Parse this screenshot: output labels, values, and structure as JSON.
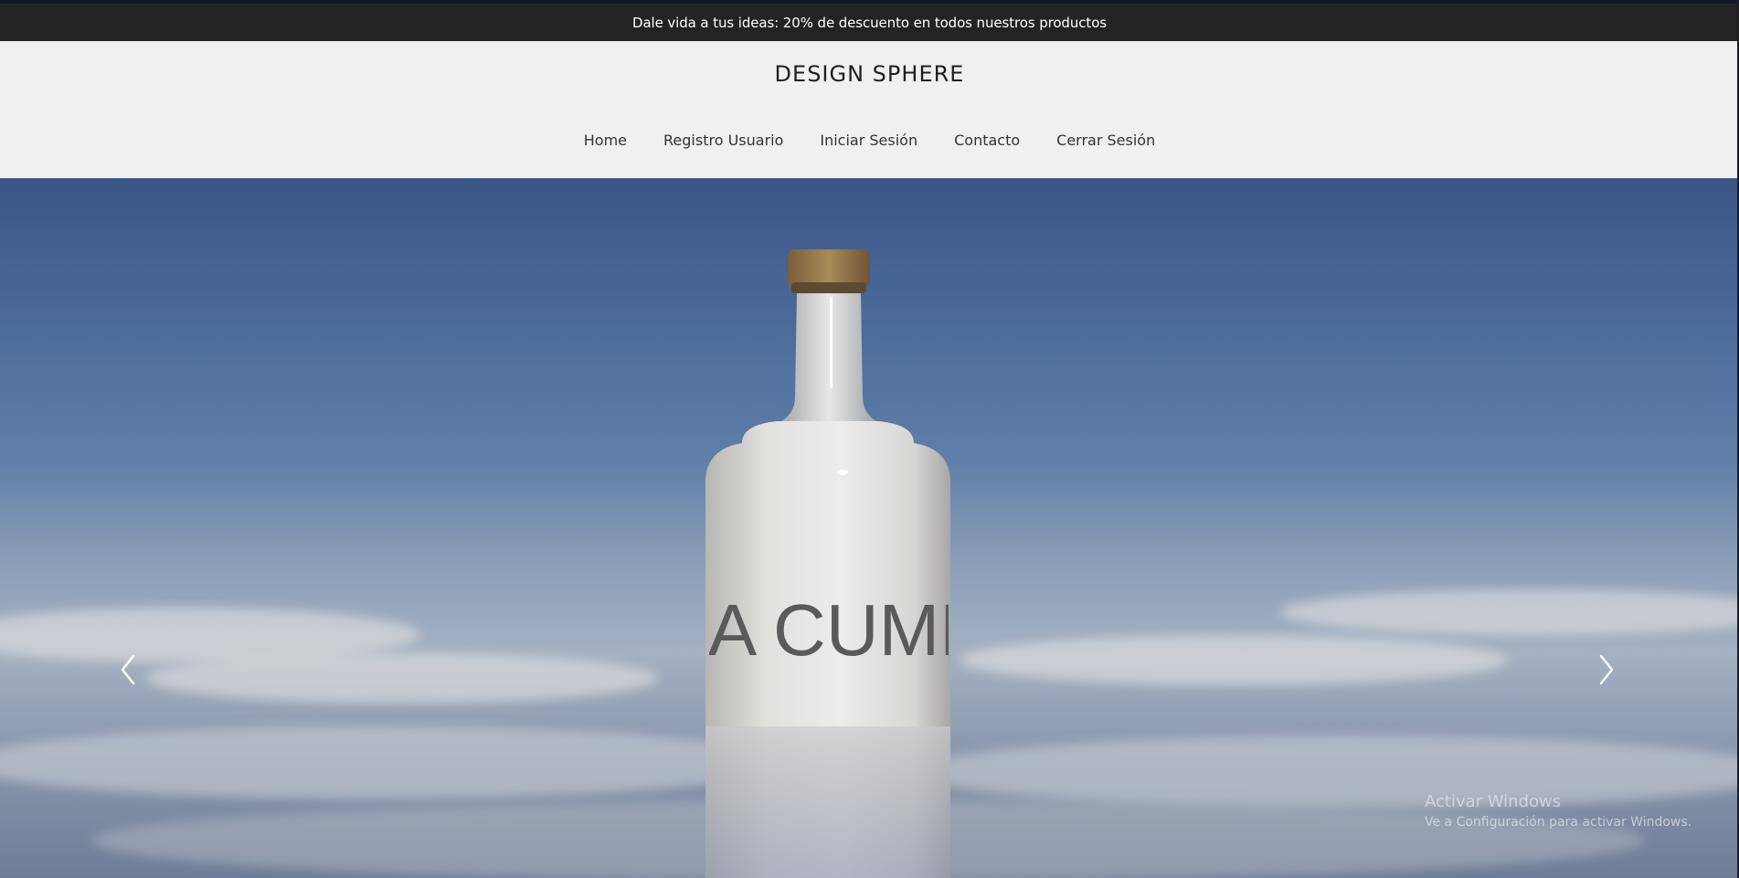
{
  "promo": {
    "text": "Dale vida a tus ideas: 20% de descuento en todos nuestros productos"
  },
  "header": {
    "brand": "DESIGN SPHERE",
    "nav": [
      {
        "label": "Home"
      },
      {
        "label": "Registro Usuario"
      },
      {
        "label": "Iniciar Sesión"
      },
      {
        "label": "Contacto"
      },
      {
        "label": "Cerrar Sesión"
      }
    ]
  },
  "hero": {
    "bottle_label": "LA CUMB",
    "prev_icon": "chevron-left-icon",
    "next_icon": "chevron-right-icon"
  },
  "watermark": {
    "title": "Activar Windows",
    "subtitle": "Ve a Configuración para activar Windows."
  },
  "colors": {
    "promo_bg": "#232323",
    "header_bg": "#f0f0f0",
    "sky_top": "#3b5585"
  }
}
